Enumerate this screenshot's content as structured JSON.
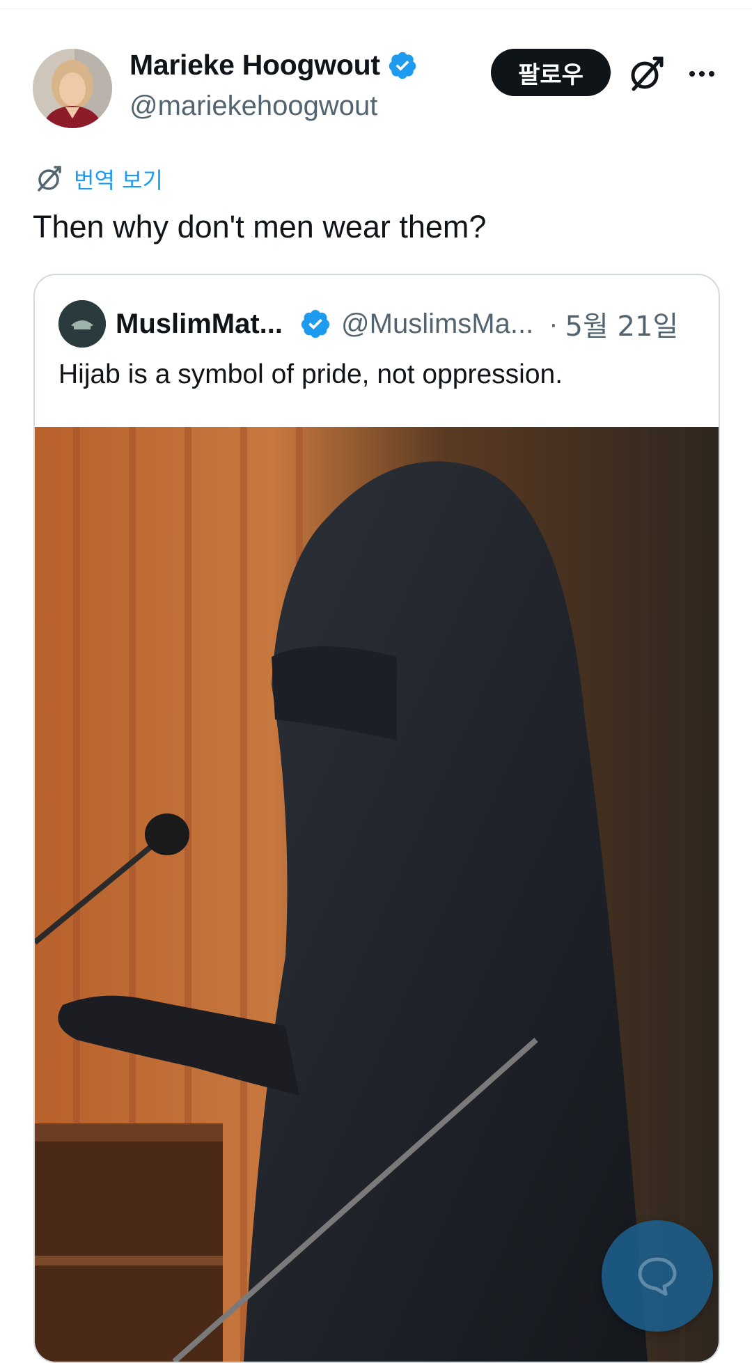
{
  "author": {
    "name": "Marieke Hoogwout",
    "handle": "@mariekehoogwout",
    "verified": true,
    "avatar_icon": "user-avatar"
  },
  "actions": {
    "follow_label": "팔로우",
    "grok_icon": "grok-icon",
    "more_icon": "more-icon"
  },
  "translate": {
    "label": "번역 보기",
    "icon": "translate-icon"
  },
  "tweet": {
    "text": "Then why don't men wear them?"
  },
  "quoted": {
    "name": "MuslimMat...",
    "handle": "@MuslimsMa...",
    "separator": "·",
    "date": "5월 21일",
    "verified": true,
    "text": "Hijab is a symbol of pride, not oppression.",
    "media_description_icon": "photo"
  },
  "fab": {
    "icon": "reply-bubble-icon"
  },
  "colors": {
    "accent": "#1d9bf0",
    "text_primary": "#0f1419",
    "text_secondary": "#536471",
    "border": "#cfd9de",
    "follow_bg": "#0f1419"
  }
}
